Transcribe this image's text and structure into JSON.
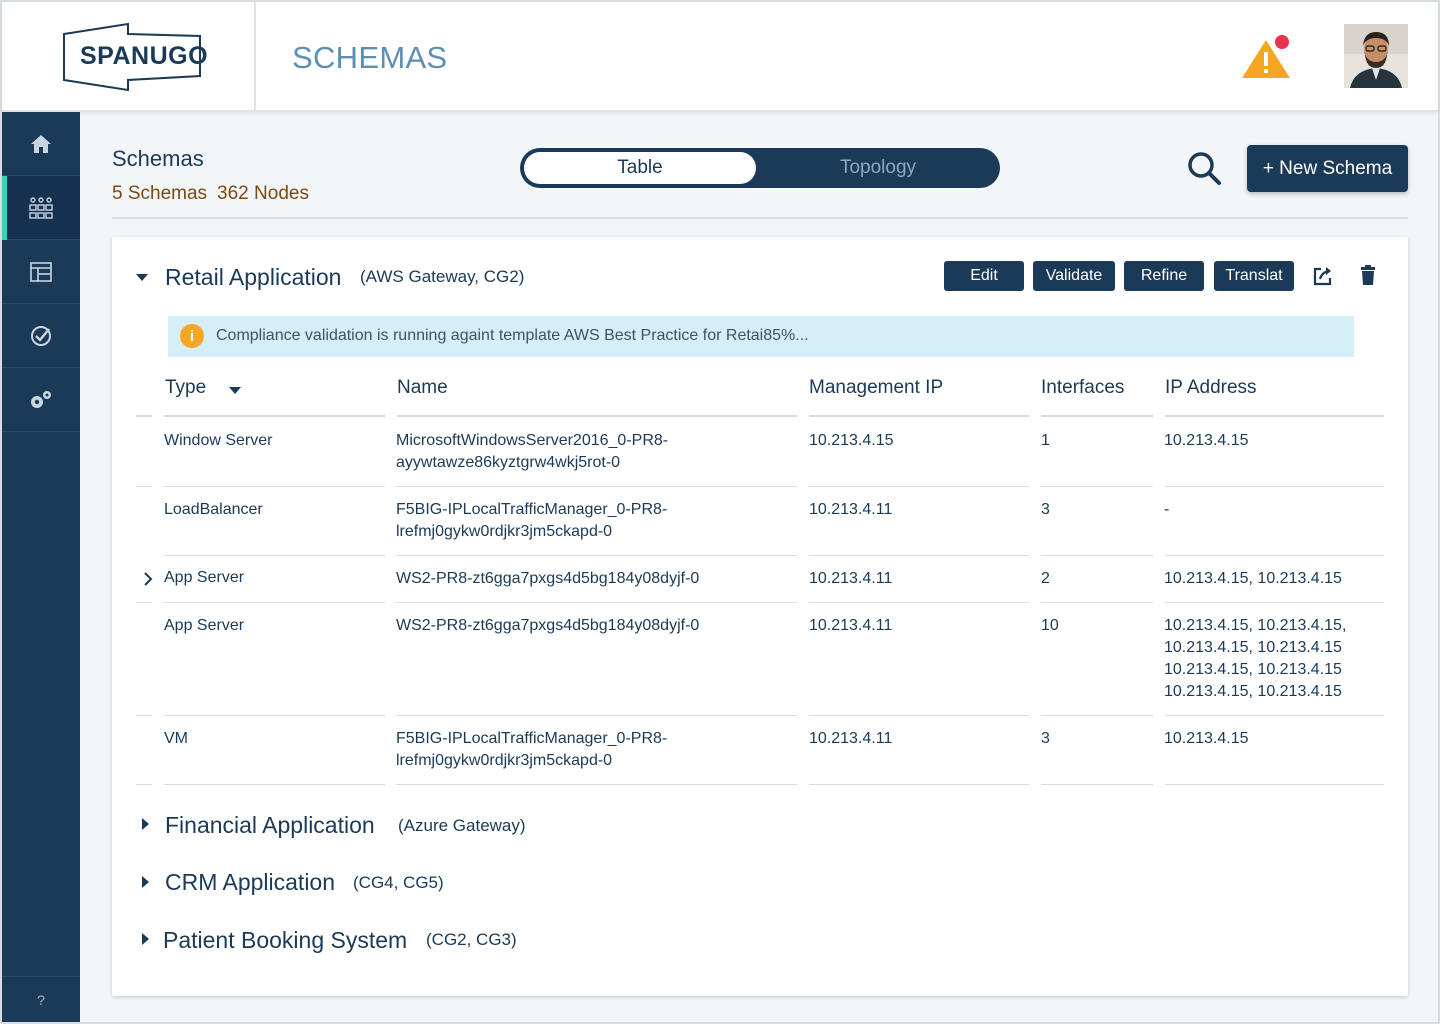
{
  "header": {
    "logo_text": "SPANUGO",
    "page_title": "SCHEMAS"
  },
  "sidebar": {
    "items": [
      {
        "icon": "home-icon"
      },
      {
        "icon": "schemas-icon",
        "active": true
      },
      {
        "icon": "layout-icon"
      },
      {
        "icon": "check-circle-icon"
      },
      {
        "icon": "settings-icon"
      }
    ],
    "help_label": "?"
  },
  "toolbar": {
    "title": "Schemas",
    "schema_count": "5 Schemas",
    "node_count": "362 Nodes",
    "toggle": {
      "active": "Table",
      "inactive": "Topology"
    },
    "new_button": "+ New Schema"
  },
  "colors": {
    "primary": "#1b3a57",
    "accent": "#3bd1b3",
    "warning": "#f5a623",
    "notification": "#e8334a",
    "banner_bg": "#d5eef7"
  },
  "expanded_schema": {
    "name": "Retail Application",
    "meta": "(AWS Gateway, CG2)",
    "actions": {
      "edit": "Edit",
      "validate": "Validate",
      "refine": "Refine",
      "translate": "Translat"
    },
    "banner": "Compliance validation is running againt template AWS Best Practice for Retai",
    "banner_progress": "85%...",
    "columns": {
      "type": "Type",
      "name": "Name",
      "mgmt_ip": "Management IP",
      "interfaces": "Interfaces",
      "ip_address": "IP Address"
    },
    "rows": [
      {
        "type": "Window Server",
        "name1": "MicrosoftWindowsServer2016_0-PR8-",
        "name2": "ayywtawze86kyztgrw4wkj5rot-0",
        "mgmt_ip": "10.213.4.15",
        "interfaces": "1",
        "ip1": "10.213.4.15"
      },
      {
        "type": "LoadBalancer",
        "name1": "F5BIG-IPLocalTrafficManager_0-PR8-",
        "name2": "lrefmj0gykw0rdjkr3jm5ckapd-0",
        "mgmt_ip": "10.213.4.11",
        "interfaces": "3",
        "ip1": "-"
      },
      {
        "type": "App Server",
        "name1": "WS2-PR8-zt6gga7pxgs4d5bg184y08dyjf-0",
        "mgmt_ip": "10.213.4.11",
        "interfaces": "2",
        "ip1": "10.213.4.15, 10.213.4.15"
      },
      {
        "type": "App Server",
        "name1": "WS2-PR8-zt6gga7pxgs4d5bg184y08dyjf-0",
        "mgmt_ip": "10.213.4.11",
        "interfaces": "10",
        "ip1": "10.213.4.15, 10.213.4.15,",
        "ip2": "10.213.4.15, 10.213.4.15",
        "ip3": "10.213.4.15, 10.213.4.15",
        "ip4": "10.213.4.15, 10.213.4.15"
      },
      {
        "type": "VM",
        "name1": "F5BIG-IPLocalTrafficManager_0-PR8-",
        "name2": "lrefmj0gykw0rdjkr3jm5ckapd-0",
        "mgmt_ip": "10.213.4.11",
        "interfaces": "3",
        "ip1": "10.213.4.15"
      }
    ]
  },
  "collapsed_schemas": [
    {
      "name": "Financial Application",
      "meta": "(Azure Gateway)"
    },
    {
      "name": "CRM Application",
      "meta": "(CG4, CG5)"
    },
    {
      "name": "Patient Booking System",
      "meta": "(CG2, CG3)"
    }
  ]
}
